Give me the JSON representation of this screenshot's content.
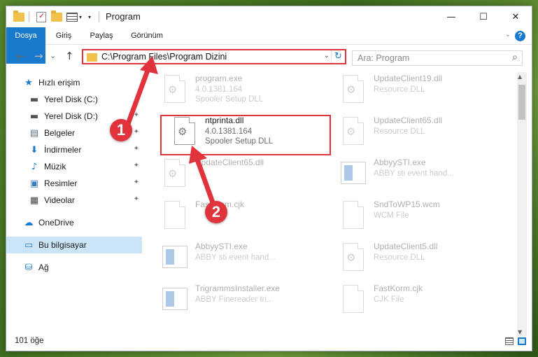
{
  "window": {
    "title": "Program",
    "minimize": "—",
    "maximize": "☐",
    "close": "✕"
  },
  "ribbon": {
    "tabs": [
      "Dosya",
      "Giriş",
      "Paylaş",
      "Görünüm"
    ],
    "help": "?"
  },
  "nav": {
    "back": "←",
    "forward": "→",
    "recent": "⌄",
    "up": "↑",
    "address": "C:\\Program Files\\Program Dizini",
    "refresh": "↻",
    "search_placeholder": "Ara: Program"
  },
  "sidebar": {
    "items": [
      {
        "label": "Hızlı erişim",
        "icon": "star-icon",
        "glyph": "★",
        "color": "#1979ca"
      },
      {
        "label": "Yerel Disk (C:)",
        "icon": "drive-icon",
        "glyph": "▬",
        "color": "#555"
      },
      {
        "label": "Yerel Disk (D:)",
        "icon": "drive-icon",
        "glyph": "▬",
        "color": "#555"
      },
      {
        "label": "Belgeler",
        "icon": "documents-icon",
        "glyph": "▤",
        "color": "#5a6f85"
      },
      {
        "label": "İndirmeler",
        "icon": "download-icon",
        "glyph": "⬇",
        "color": "#1979ca"
      },
      {
        "label": "Müzik",
        "icon": "music-icon",
        "glyph": "♪",
        "color": "#1979ca"
      },
      {
        "label": "Resimler",
        "icon": "pictures-icon",
        "glyph": "▣",
        "color": "#3a7bbf"
      },
      {
        "label": "Videolar",
        "icon": "video-icon",
        "glyph": "▦",
        "color": "#444"
      },
      {
        "label": "OneDrive",
        "icon": "cloud-icon",
        "glyph": "☁",
        "color": "#1979ca"
      },
      {
        "label": "Bu bilgisayar",
        "icon": "computer-icon",
        "glyph": "▭",
        "color": "#1979ca"
      },
      {
        "label": "Ağ",
        "icon": "network-icon",
        "glyph": "⛁",
        "color": "#1979ca"
      }
    ],
    "pin": "📌"
  },
  "files": {
    "left": [
      {
        "name": "program.exe",
        "line1": "4.0.1381.164",
        "line2": "Spooler Setup DLL",
        "type": "exe"
      },
      {
        "name": "ntprinta.dll",
        "line1": "4.0.1381.164",
        "line2": "Spooler Setup DLL",
        "type": "dll"
      },
      {
        "name": "UpdateClient65.dll",
        "line1": "",
        "line2": "",
        "type": "dll"
      },
      {
        "name": "FastKorm.cjk",
        "line1": "",
        "line2": "",
        "type": "doc"
      },
      {
        "name": "AbbyySTI.exe",
        "line1": "ABBY sti event hand...",
        "line2": "",
        "type": "app"
      },
      {
        "name": "TrigrammsInstaller.exe",
        "line1": "ABBY Finereader tri...",
        "line2": "",
        "type": "app"
      }
    ],
    "right": [
      {
        "name": "UpdateClient19.dll",
        "line1": "Resource DLL",
        "type": "dll"
      },
      {
        "name": "UpdateClient65.dll",
        "line1": "Resource DLL",
        "type": "dll"
      },
      {
        "name": "AbbyySTI.exe",
        "line1": "ABBY sti event hand...",
        "type": "app"
      },
      {
        "name": "SndToWP15.wcm",
        "line1": "WCM File",
        "type": "doc"
      },
      {
        "name": "UpdateClient5.dll",
        "line1": "Resource DLL",
        "type": "dll"
      },
      {
        "name": "FastKorm.cjk",
        "line1": "CJK File",
        "type": "doc"
      }
    ]
  },
  "status": {
    "count": "101 öğe"
  },
  "annotations": {
    "badge1": "1",
    "badge2": "2"
  },
  "colors": {
    "accent": "#1979ca",
    "highlight": "#e0333c"
  }
}
